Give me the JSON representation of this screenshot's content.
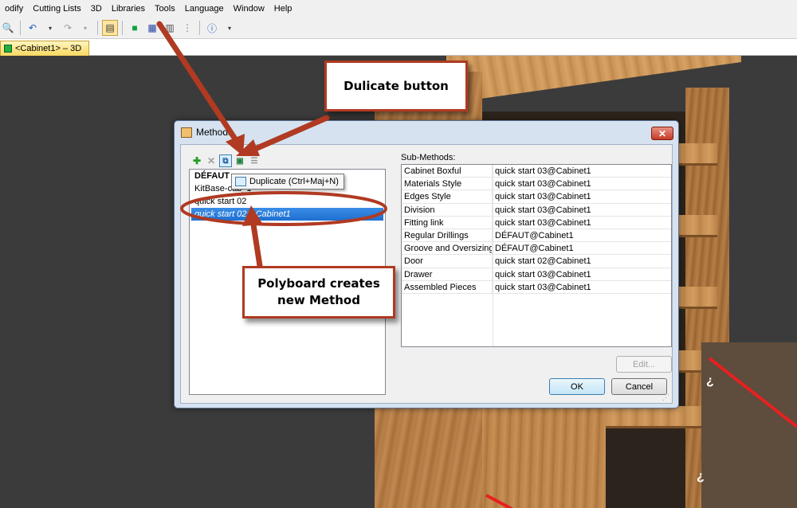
{
  "menubar": {
    "items": [
      "odify",
      "Cutting Lists",
      "3D",
      "Libraries",
      "Tools",
      "Language",
      "Window",
      "Help"
    ]
  },
  "tab": {
    "label": "<Cabinet1> – 3D"
  },
  "dialog": {
    "title": "Methods",
    "close_label": "✕",
    "methods": [
      {
        "label": "DÉFAUT",
        "style": "bold"
      },
      {
        "label": "KitBase-cab_1",
        "style": "normal"
      },
      {
        "label": "quick start 02",
        "style": "normal"
      },
      {
        "label": "quick start 02@Cabinet1",
        "style": "selected"
      }
    ],
    "tooltip": "Duplicate (Ctrl+Maj+N)",
    "sub_methods_label": "Sub-Methods:",
    "sub_methods": [
      {
        "name": "Cabinet Boxful",
        "value": "quick start 03@Cabinet1"
      },
      {
        "name": "Materials Style",
        "value": "quick start 03@Cabinet1"
      },
      {
        "name": "Edges Style",
        "value": "quick start 03@Cabinet1"
      },
      {
        "name": "Division",
        "value": "quick start 03@Cabinet1"
      },
      {
        "name": "Fitting link",
        "value": "quick start 03@Cabinet1"
      },
      {
        "name": "Regular Drillings",
        "value": "DÉFAUT@Cabinet1"
      },
      {
        "name": "Groove and Oversizing",
        "value": "DÉFAUT@Cabinet1"
      },
      {
        "name": "Door",
        "value": "quick start 02@Cabinet1"
      },
      {
        "name": "Drawer",
        "value": "quick start 03@Cabinet1"
      },
      {
        "name": "Assembled Pieces",
        "value": "quick start 03@Cabinet1"
      }
    ],
    "edit_label": "Edit...",
    "ok_label": "OK",
    "cancel_label": "Cancel"
  },
  "callouts": {
    "duplicate": "Dulicate button",
    "creates_line1": "Polyboard creates",
    "creates_line2": "new Method"
  },
  "colors": {
    "arrow": "#b03a22",
    "selection": "#1e6fd0",
    "highlight_ellipse": "#b03a22"
  }
}
